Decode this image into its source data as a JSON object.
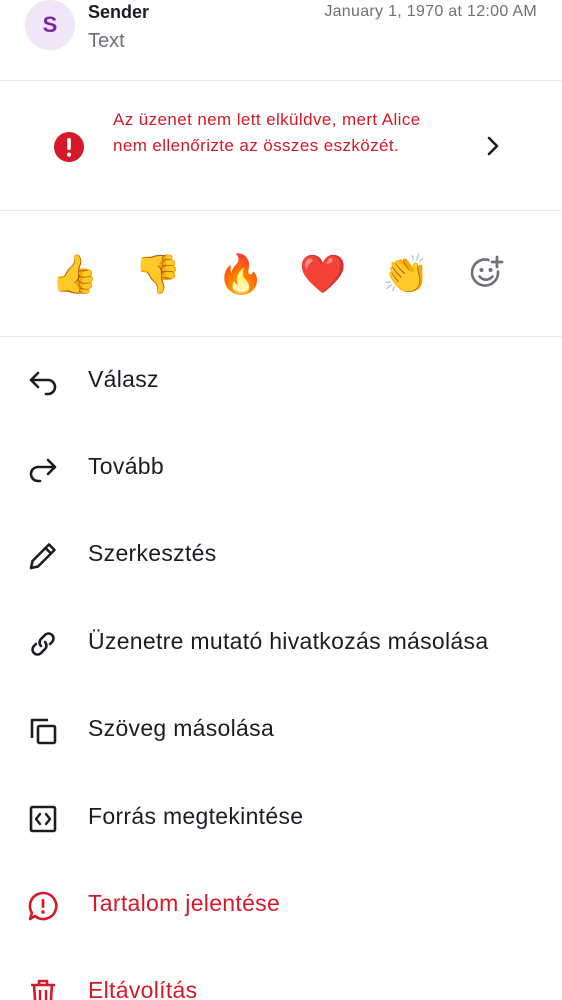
{
  "message": {
    "avatar_initial": "S",
    "sender": "Sender",
    "preview": "Text",
    "timestamp": "January 1, 1970 at 12:00 AM"
  },
  "warning": {
    "text": "Az üzenet nem lett elküldve, mert Alice nem ellenőrizte az összes eszközét.",
    "icon": "error-icon",
    "color": "#d51928"
  },
  "reactions": [
    {
      "emoji": "👍",
      "name": "thumbs-up"
    },
    {
      "emoji": "👎",
      "name": "thumbs-down"
    },
    {
      "emoji": "🔥",
      "name": "fire"
    },
    {
      "emoji": "❤️",
      "name": "heart"
    },
    {
      "emoji": "👏",
      "name": "clap"
    }
  ],
  "add_reaction_icon": "add-reaction-icon",
  "menu": {
    "reply": "Válasz",
    "forward": "Tovább",
    "edit": "Szerkesztés",
    "copy_link": "Üzenetre mutató hivatkozás másolása",
    "copy_text": "Szöveg másolása",
    "view_source": "Forrás megtekintése",
    "report": "Tartalom jelentése",
    "remove": "Eltávolítás"
  },
  "colors": {
    "danger": "#d51928",
    "avatar_bg": "#f1e5f8",
    "avatar_fg": "#7b25a6"
  }
}
